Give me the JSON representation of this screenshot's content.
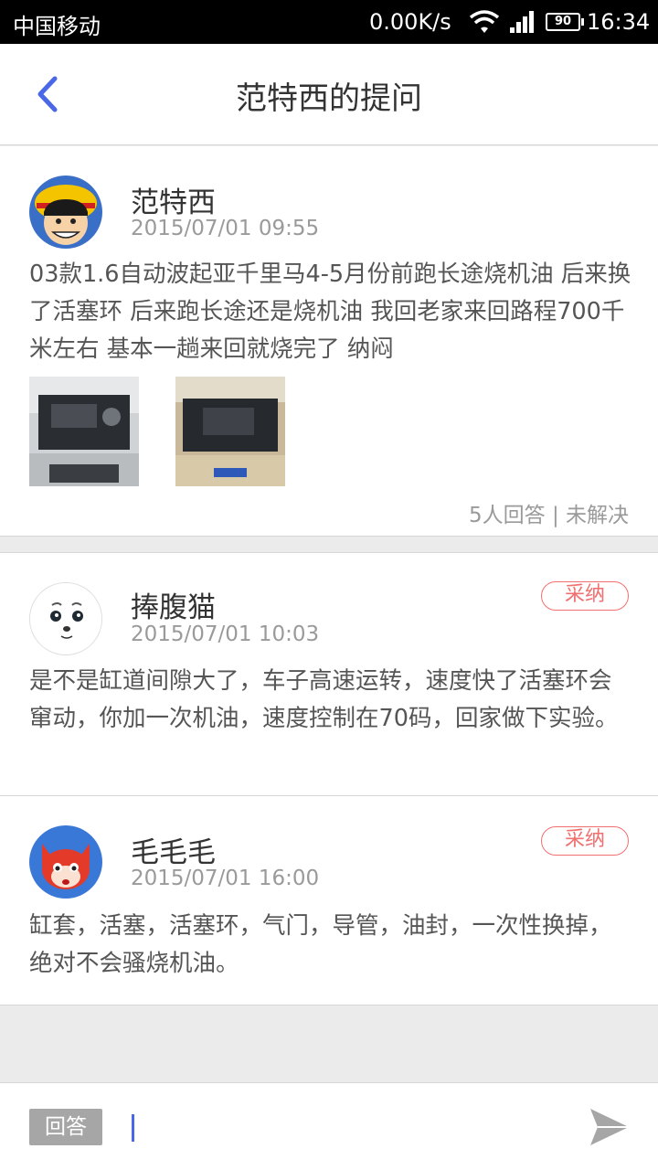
{
  "status_bar": {
    "carrier": "中国移动",
    "net_speed": "0.00K/s",
    "battery": "90",
    "time": "16:34"
  },
  "nav": {
    "title": "范特西的提问",
    "back_icon": "chevron-left-icon"
  },
  "question": {
    "user": "范特西",
    "date": "2015/07/01  09:55",
    "text": "03款1.6自动波起亚千里马4-5月份前跑长途烧机油 后来换了活塞环  后来跑长途还是烧机油  我回老家来回路程700千米左右 基本一趟来回就烧完了 纳闷",
    "answer_count": "5人回答",
    "separator": "|",
    "status": "未解决"
  },
  "answers": [
    {
      "user": "捧腹猫",
      "date": "2015/07/01  10:03",
      "text": "是不是缸道间隙大了，车子高速运转，速度快了活塞环会窜动，你加一次机油，速度控制在70码，回家做下实验。",
      "adopt_label": "采纳"
    },
    {
      "user": "毛毛毛",
      "date": "2015/07/01  16:00",
      "text": "缸套，活塞，活塞环，气门，导管，油封，一次性换掉，绝对不会骚烧机油。",
      "adopt_label": "采纳"
    }
  ],
  "reply_bar": {
    "tag": "回答",
    "send_icon": "send-icon"
  },
  "colors": {
    "accent": "#4a67e8",
    "adopt": "#f07070",
    "muted_text": "#9a9a9a",
    "background": "#ebebeb"
  }
}
